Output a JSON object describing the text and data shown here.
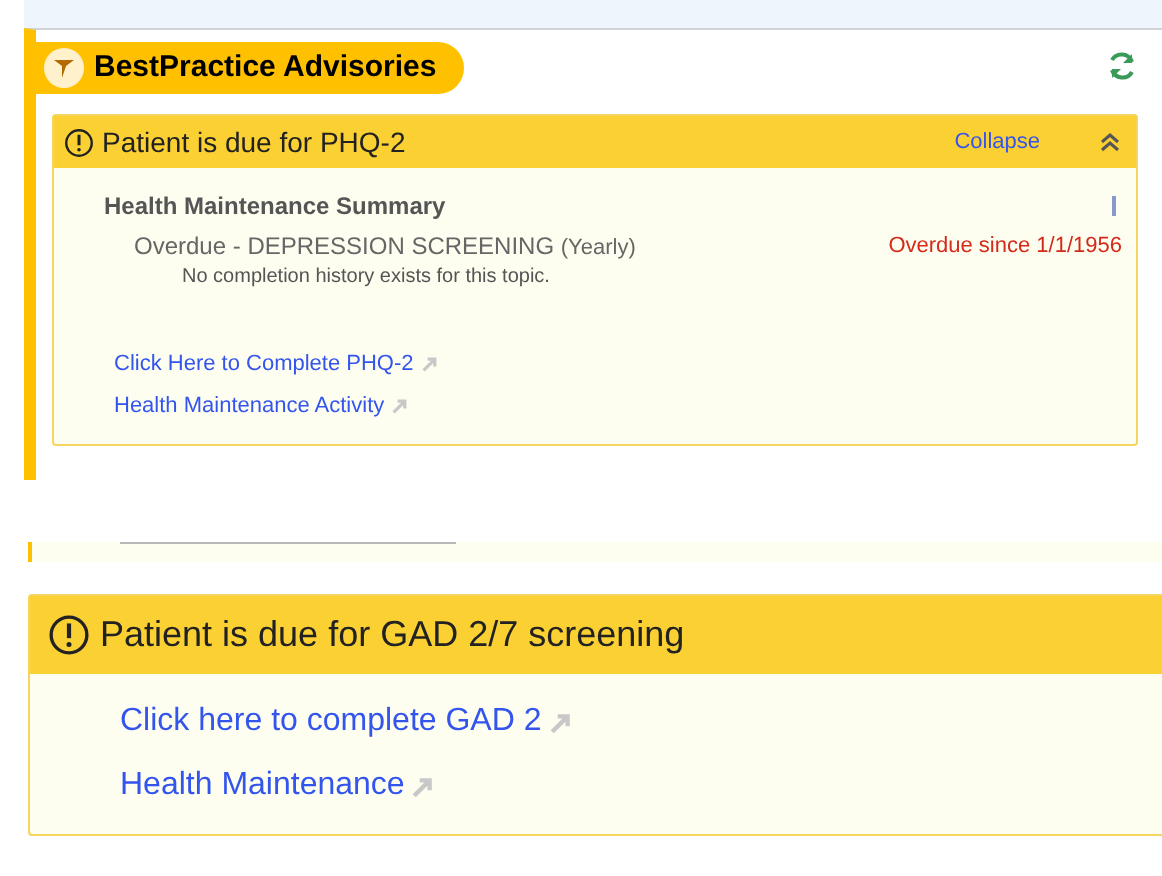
{
  "panel": {
    "title": "BestPractice Advisories"
  },
  "advisories": [
    {
      "title": "Patient is due for PHQ-2",
      "collapse": "Collapse",
      "expanded": true,
      "summary_title": "Health Maintenance Summary",
      "topic": "Overdue - DEPRESSION SCREENING",
      "frequency": "(Yearly)",
      "status": "Overdue since 1/1/1956",
      "note": "No completion history exists for this topic.",
      "links": [
        "Click Here to Complete PHQ-2",
        "Health Maintenance Activity"
      ]
    },
    {
      "title": "Patient is due for GAD 2/7 screening",
      "links": [
        "Click here to complete GAD 2",
        "Health Maintenance"
      ]
    }
  ]
}
